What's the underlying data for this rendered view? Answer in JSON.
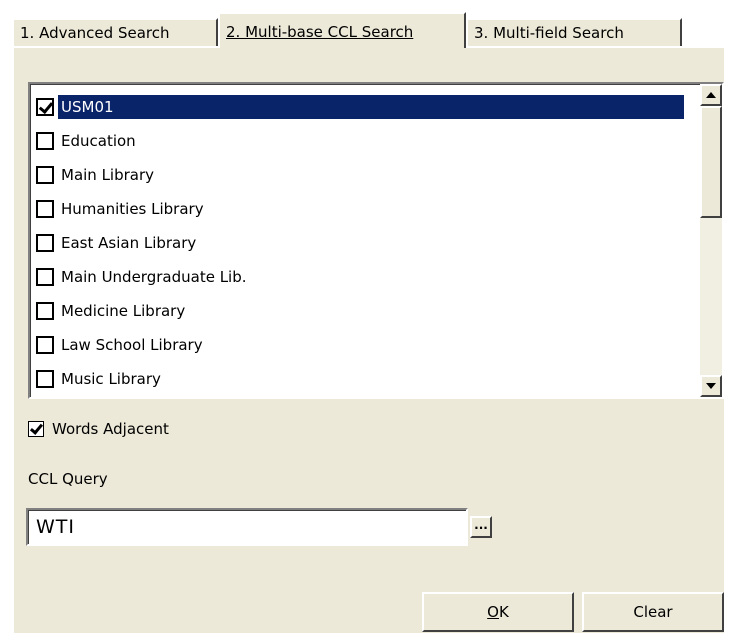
{
  "tabs": [
    {
      "label": "1. Advanced Search"
    },
    {
      "label": "2. Multi-base CCL Search"
    },
    {
      "label": "3. Multi-field Search"
    }
  ],
  "databases": [
    {
      "label": "USM01",
      "checked": true,
      "selected": true
    },
    {
      "label": "Education",
      "checked": false
    },
    {
      "label": "Main Library",
      "checked": false
    },
    {
      "label": "Humanities Library",
      "checked": false
    },
    {
      "label": "East Asian Library",
      "checked": false
    },
    {
      "label": "Main Undergraduate Lib.",
      "checked": false
    },
    {
      "label": "Medicine Library",
      "checked": false
    },
    {
      "label": "Law School Library",
      "checked": false
    },
    {
      "label": "Music Library",
      "checked": false
    }
  ],
  "words_adjacent": {
    "label": "Words Adjacent",
    "checked": true
  },
  "ccl": {
    "label": "CCL Query",
    "value": "WTI",
    "browse_label": "..."
  },
  "buttons": {
    "ok_mnemonic": "O",
    "ok_rest": "K",
    "clear": "Clear"
  },
  "colors": {
    "selection": "#0a246a",
    "face": "#ece9d8"
  }
}
